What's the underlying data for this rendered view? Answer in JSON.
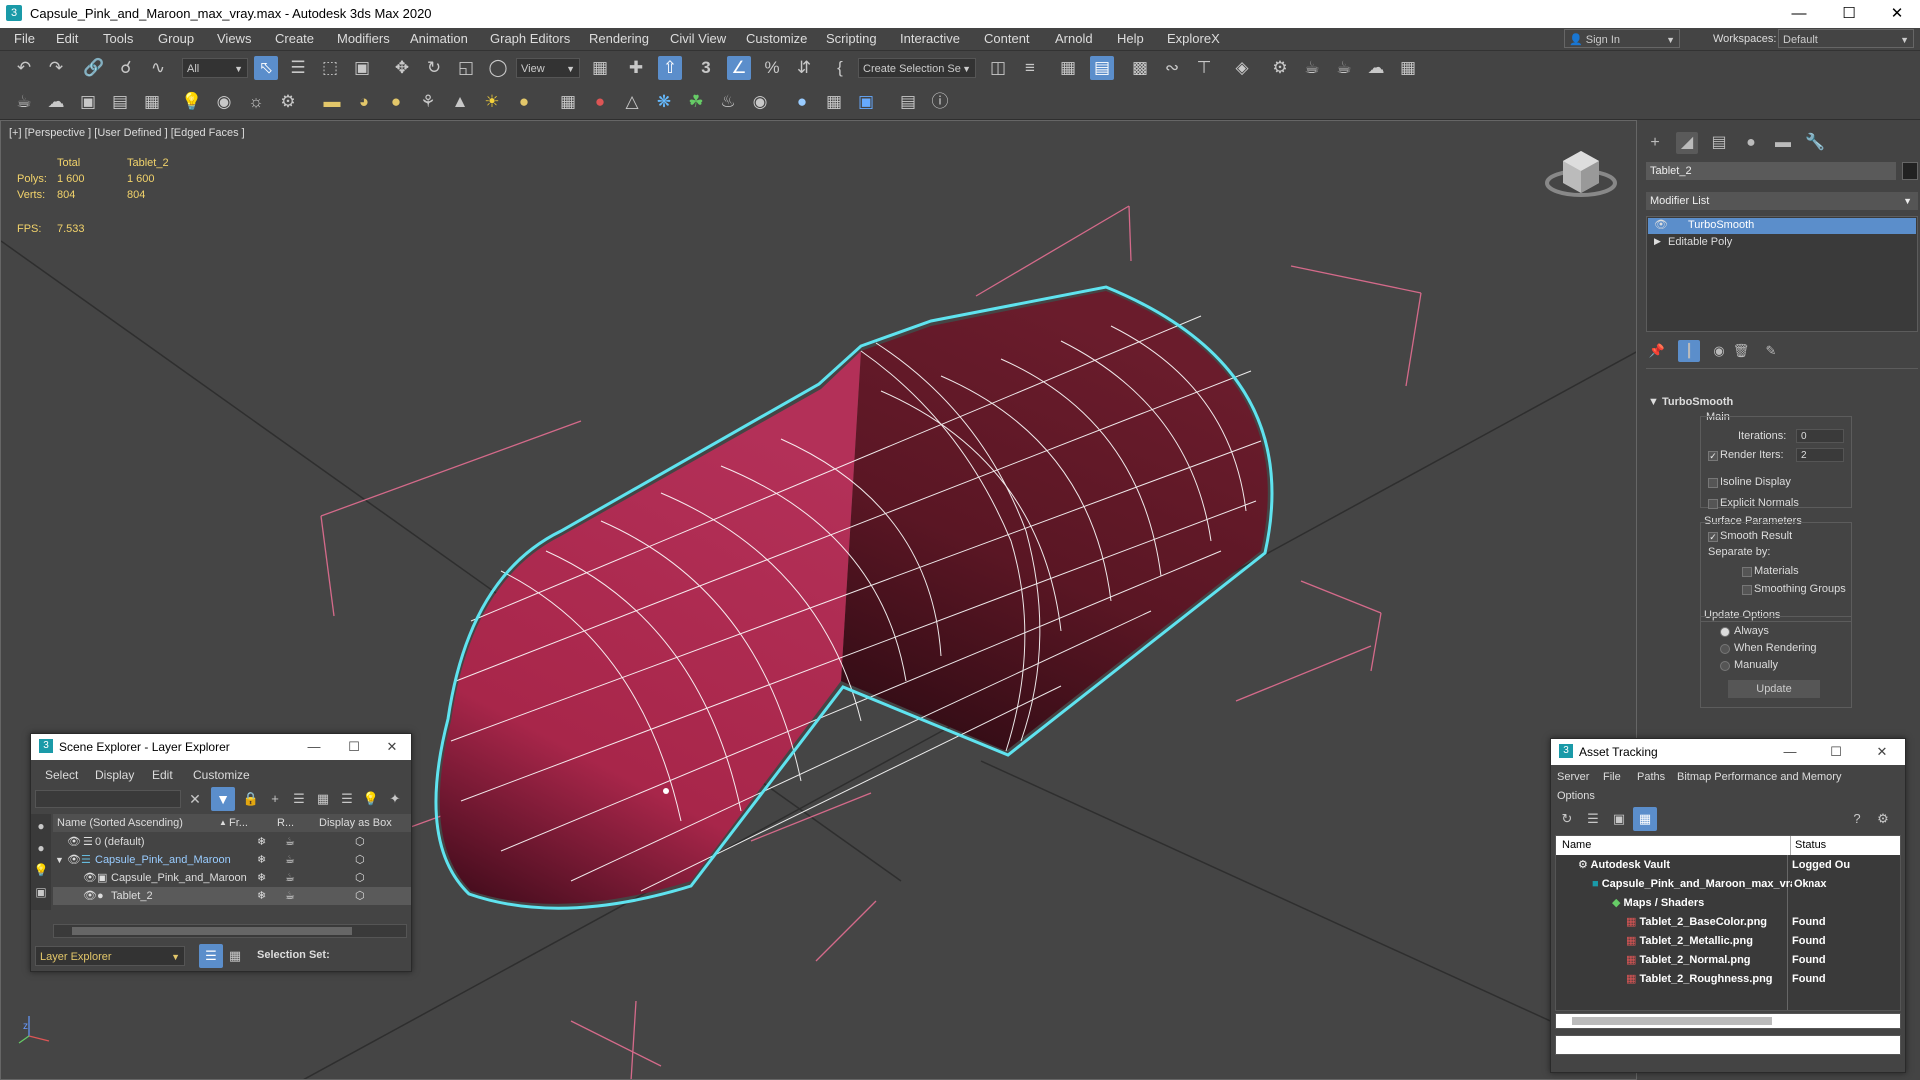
{
  "window": {
    "title": "Capsule_Pink_and_Maroon_max_vray.max - Autodesk 3ds Max 2020",
    "app_icon": "3"
  },
  "menu": [
    "File",
    "Edit",
    "Tools",
    "Group",
    "Views",
    "Create",
    "Modifiers",
    "Animation",
    "Graph Editors",
    "Rendering",
    "Civil View",
    "Customize",
    "Scripting",
    "Interactive",
    "Content",
    "Arnold",
    "Help",
    "ExploreX"
  ],
  "signin": {
    "label": "Sign In"
  },
  "workspace": {
    "label": "Workspaces:",
    "value": "Default"
  },
  "toolbar": {
    "filter_value": "All",
    "ref_coord": "View",
    "selection_set_placeholder": "Create Selection Se",
    "snap_label": "3"
  },
  "viewport": {
    "label": "[+] [Perspective ] [User Defined ] [Edged Faces ]",
    "stats": {
      "col_total": "Total",
      "col_obj": "Tablet_2",
      "polys_label": "Polys:",
      "polys_total": "1 600",
      "polys_obj": "1 600",
      "verts_label": "Verts:",
      "verts_total": "804",
      "verts_obj": "804",
      "fps_label": "FPS:",
      "fps_value": "7.533"
    },
    "axis_z": "z"
  },
  "command_panel": {
    "object_name": "Tablet_2",
    "modifier_list": "Modifier List",
    "stack": [
      "TurboSmooth",
      "Editable Poly"
    ],
    "turbosmooth": {
      "title": "TurboSmooth",
      "main": "Main",
      "iterations_label": "Iterations:",
      "iterations": "0",
      "render_iters_label": "Render Iters:",
      "render_iters": "2",
      "isoline": "Isoline Display",
      "explicit": "Explicit Normals",
      "surface_params": "Surface Parameters",
      "smooth_result": "Smooth Result",
      "separate_by": "Separate by:",
      "materials": "Materials",
      "smoothing_groups": "Smoothing Groups",
      "update_options": "Update Options",
      "always": "Always",
      "when_rendering": "When Rendering",
      "manually": "Manually",
      "update_btn": "Update"
    }
  },
  "scene_explorer": {
    "title": "Scene Explorer - Layer Explorer",
    "menu": [
      "Select",
      "Display",
      "Edit",
      "Customize"
    ],
    "columns": [
      "Name (Sorted Ascending)",
      "Fr...",
      "R...",
      "Display as Box"
    ],
    "rows": [
      "0 (default)",
      "Capsule_Pink_and_Maroon",
      "Capsule_Pink_and_Maroon",
      "Tablet_2"
    ],
    "footer_combo": "Layer Explorer",
    "selection_set": "Selection Set:"
  },
  "asset_tracking": {
    "title": "Asset Tracking",
    "menu": [
      "Server",
      "File",
      "Paths",
      "Bitmap Performance and Memory",
      "Options"
    ],
    "columns": [
      "Name",
      "Status"
    ],
    "rows": [
      {
        "name": "Autodesk Vault",
        "status": "Logged Ou"
      },
      {
        "name": "Capsule_Pink_and_Maroon_max_vray.max",
        "status": "Ok"
      },
      {
        "name": "Maps / Shaders",
        "status": ""
      },
      {
        "name": "Tablet_2_BaseColor.png",
        "status": "Found"
      },
      {
        "name": "Tablet_2_Metallic.png",
        "status": "Found"
      },
      {
        "name": "Tablet_2_Normal.png",
        "status": "Found"
      },
      {
        "name": "Tablet_2_Roughness.png",
        "status": "Found"
      }
    ]
  },
  "colors": {
    "accent": "#5b8ecb",
    "selection_outline": "#5fe3ef",
    "capsule_pink": "#a8264a",
    "capsule_maroon": "#5a1624",
    "stats_text": "#f2d36b",
    "grid": "#d46a8a"
  }
}
